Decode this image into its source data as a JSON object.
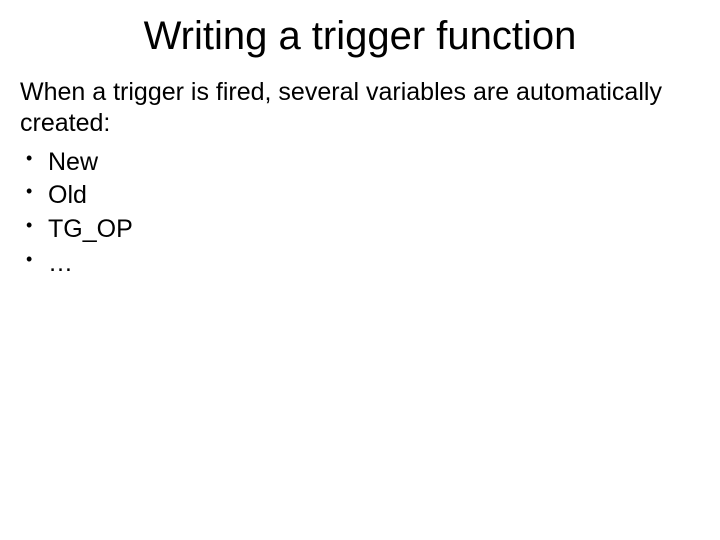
{
  "title": "Writing a trigger function",
  "intro": "When a trigger is fired, several variables are automatically created:",
  "bullets": [
    "New",
    "Old",
    "TG_OP",
    "…"
  ]
}
